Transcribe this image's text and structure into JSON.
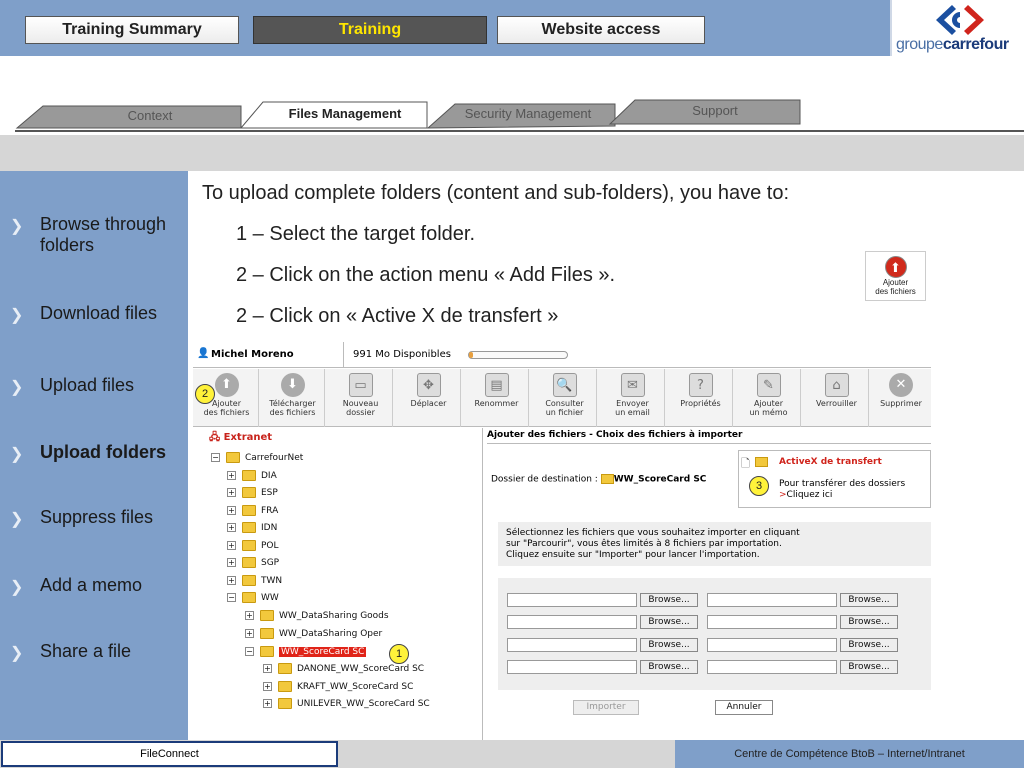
{
  "nav": {
    "buttons": [
      "Training Summary",
      "Training",
      "Website access"
    ],
    "logo_prefix": "groupe",
    "logo_brand": "carrefour"
  },
  "tabs": [
    "Context",
    "Files Management",
    "Security Management",
    "Support"
  ],
  "sidebar": {
    "items": [
      {
        "label": "Browse through folders"
      },
      {
        "label": "Download files"
      },
      {
        "label": "Upload files"
      },
      {
        "label": "Upload folders"
      },
      {
        "label": "Suppress files"
      },
      {
        "label": "Add a memo"
      },
      {
        "label": "Share a file"
      }
    ]
  },
  "content": {
    "intro": "To upload complete folders (content and sub-folders), you have to:",
    "step1": "1 – Select the target folder.",
    "step2": "2 – Click on the action menu « Add Files ».",
    "step3": "2 – Click on « Active X de transfert »",
    "add_icon_label1": "Ajouter",
    "add_icon_label2": "des fichiers"
  },
  "app": {
    "user": "Michel Moreno",
    "space": "991 Mo Disponibles",
    "toolbar": [
      {
        "l1": "Ajouter",
        "l2": "des fichiers",
        "icon": "upload-icon"
      },
      {
        "l1": "Télécharger",
        "l2": "des fichiers",
        "icon": "download-icon"
      },
      {
        "l1": "Nouveau",
        "l2": "dossier",
        "icon": "new-folder-icon"
      },
      {
        "l1": "Déplacer",
        "l2": "",
        "icon": "move-icon"
      },
      {
        "l1": "Renommer",
        "l2": "",
        "icon": "rename-icon"
      },
      {
        "l1": "Consulter",
        "l2": "un fichier",
        "icon": "view-file-icon"
      },
      {
        "l1": "Envoyer",
        "l2": "un email",
        "icon": "email-icon"
      },
      {
        "l1": "Propriétés",
        "l2": "",
        "icon": "properties-icon"
      },
      {
        "l1": "Ajouter",
        "l2": "un mémo",
        "icon": "memo-icon"
      },
      {
        "l1": "Verrouiller",
        "l2": "",
        "icon": "lock-icon"
      },
      {
        "l1": "Supprimer",
        "l2": "",
        "icon": "delete-icon"
      }
    ],
    "tree_root": "Extranet",
    "tree": [
      "CarrefourNet",
      "DIA",
      "ESP",
      "FRA",
      "IDN",
      "POL",
      "SGP",
      "TWN",
      "WW",
      "WW_DataSharing Goods",
      "WW_DataSharing Oper",
      "WW_ScoreCard SC",
      "DANONE_WW_ScoreCard SC",
      "KRAFT_WW_ScoreCard SC",
      "UNILEVER_WW_ScoreCard SC"
    ],
    "panel_title": "Ajouter des fichiers - Choix des fichiers à importer",
    "dest_label": "Dossier de destination :",
    "dest_folder": "WW_ScoreCard SC",
    "activex_title": "ActiveX de transfert",
    "activex_line1": "Pour transférer des dossiers",
    "activex_line2": "Cliquez ici",
    "activex_arrow": ">",
    "instr1": "Sélectionnez les fichiers que vous souhaitez importer en cliquant",
    "instr2": "sur \"Parcourir\", vous êtes limités à 8 fichiers par importation.",
    "instr3": "Cliquez ensuite sur \"Importer\" pour lancer l'importation.",
    "browse": "Browse...",
    "import_btn": "Importer",
    "cancel_btn": "Annuler",
    "badges": [
      "1",
      "2",
      "3"
    ]
  },
  "footer": {
    "left": "FileConnect",
    "right": "Centre de Compétence BtoB – Internet/Intranet"
  }
}
